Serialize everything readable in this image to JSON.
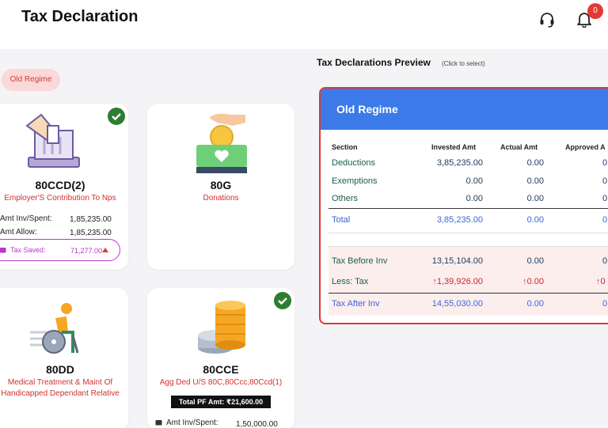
{
  "header": {
    "title": "Tax Declaration",
    "notification_count": "0",
    "support_icon": "headset-icon",
    "notification_icon": "bell-icon"
  },
  "regime_filter": {
    "label": "Old Regime"
  },
  "cards": [
    {
      "code": "80CCD(2)",
      "description": "Employer'S Contribution To Nps",
      "icon": "ballot-box-icon",
      "selected": true,
      "amt_inv_label": "Amt Inv/Spent:",
      "amt_inv_value": "1,85,235.00",
      "amt_allow_label": "Amt Allow:",
      "amt_allow_value": "1,85,235.00",
      "tax_saved_label": "Tax Saved:",
      "tax_saved_value": "71,277.00"
    },
    {
      "code": "80G",
      "description": "Donations",
      "icon": "donation-box-icon",
      "selected": false
    },
    {
      "code": "80DD",
      "description_line1": "Medical Treatment & Maint Of",
      "description_line2": "Handicapped Dependant Relative",
      "icon": "wheelchair-icon",
      "selected": false
    },
    {
      "code": "80CCE",
      "description": "Agg Ded U/S 80C,80Ccc,80Ccd(1)",
      "icon": "coins-icon",
      "selected": true,
      "pf_label": "Total PF Amt: ₹21,600.00",
      "amt_inv_label": "Amt Inv/Spent:",
      "amt_inv_value": "1,50,000.00"
    }
  ],
  "preview": {
    "title": "Tax Declarations Preview",
    "subtitle": "(Click to select)",
    "panel_title": "Old Regime",
    "columns": [
      "Section",
      "Invested Amt",
      "Actual Amt",
      "Approved A"
    ],
    "rows": [
      {
        "section": "Deductions",
        "invested": "3,85,235.00",
        "actual": "0.00",
        "approved": "0"
      },
      {
        "section": "Exemptions",
        "invested": "0.00",
        "actual": "0.00",
        "approved": "0"
      },
      {
        "section": "Others",
        "invested": "0.00",
        "actual": "0.00",
        "approved": "0"
      }
    ],
    "total": {
      "section": "Total",
      "invested": "3,85,235.00",
      "actual": "0.00",
      "approved": "0"
    },
    "tax_before": {
      "section": "Tax Before Inv",
      "invested": "13,15,104.00",
      "actual": "0.00",
      "approved": "0"
    },
    "less_tax": {
      "section": "Less: Tax",
      "invested": "1,39,926.00",
      "actual": "0.00",
      "approved": "0"
    },
    "tax_after": {
      "section": "Tax After Inv",
      "invested": "14,55,030.00",
      "actual": "0.00",
      "approved": "0"
    }
  },
  "colors": {
    "accent_blue": "#3b7ae8",
    "panel_border": "#e03535",
    "description_red": "#d32f2f",
    "tax_saved_purple": "#b43ac4",
    "check_green": "#2e7d32"
  }
}
